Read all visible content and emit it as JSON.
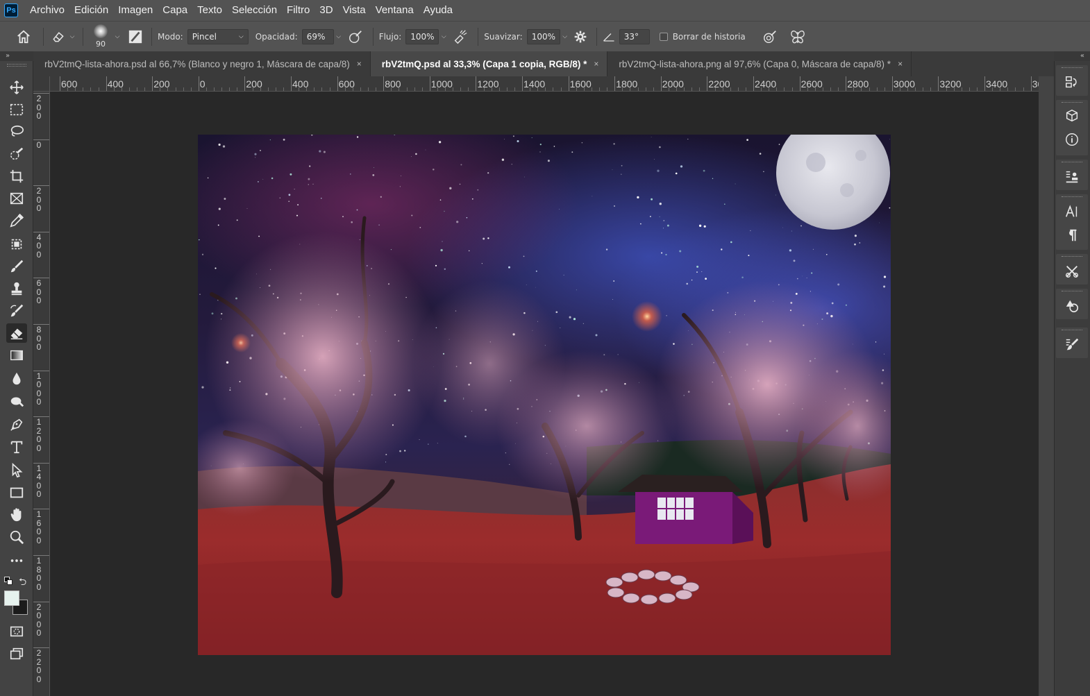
{
  "app": {
    "logo": "Ps"
  },
  "menu": [
    "Archivo",
    "Edición",
    "Imagen",
    "Capa",
    "Texto",
    "Selección",
    "Filtro",
    "3D",
    "Vista",
    "Ventana",
    "Ayuda"
  ],
  "options": {
    "brush_size": "90",
    "mode_label": "Modo:",
    "mode_value": "Pincel",
    "opacity_label": "Opacidad:",
    "opacity_value": "69%",
    "flow_label": "Flujo:",
    "flow_value": "100%",
    "smoothing_label": "Suavizar:",
    "smoothing_value": "100%",
    "angle_value": "33°",
    "erase_history_label": "Borrar de historia"
  },
  "tabs": [
    {
      "title": "rbV2tmQ-lista-ahora.psd al 66,7% (Blanco y negro 1, Máscara de capa/8)",
      "active": false
    },
    {
      "title": "rbV2tmQ.psd al 33,3% (Capa 1 copia, RGB/8) *",
      "active": true
    },
    {
      "title": "rbV2tmQ-lista-ahora.png al 97,6% (Capa 0, Máscara de capa/8) *",
      "active": false
    }
  ],
  "close_glyph": "×",
  "collapse_left": "»",
  "collapse_right": "«",
  "ruler_h": [
    "600",
    "400",
    "200",
    "0",
    "200",
    "400",
    "600",
    "800",
    "1000",
    "1200",
    "1400",
    "1600",
    "1800",
    "2000",
    "2200",
    "2400",
    "2600",
    "2800",
    "3000",
    "3200",
    "3400",
    "36"
  ],
  "ruler_v": [
    "200",
    "0",
    "200",
    "400",
    "600",
    "800",
    "1000",
    "1200",
    "1400",
    "1600",
    "1800",
    "2000",
    "2200"
  ],
  "tools": [
    {
      "name": "move-tool",
      "icon": "move-icon"
    },
    {
      "name": "marquee-tool",
      "icon": "rect-marquee-icon"
    },
    {
      "name": "lasso-tool",
      "icon": "lasso-icon"
    },
    {
      "name": "quick-selection-tool",
      "icon": "quick-selection-icon"
    },
    {
      "name": "crop-tool",
      "icon": "crop-icon"
    },
    {
      "name": "frame-tool",
      "icon": "frame-icon"
    },
    {
      "name": "eyedropper-tool",
      "icon": "eyedropper-icon"
    },
    {
      "name": "healing-tool",
      "icon": "healing-icon"
    },
    {
      "name": "brush-tool",
      "icon": "brush-icon"
    },
    {
      "name": "stamp-tool",
      "icon": "stamp-icon"
    },
    {
      "name": "history-brush-tool",
      "icon": "history-brush-icon"
    },
    {
      "name": "eraser-tool",
      "icon": "eraser-icon",
      "active": true
    },
    {
      "name": "gradient-tool",
      "icon": "gradient-icon"
    },
    {
      "name": "blur-tool",
      "icon": "blur-drop-icon"
    },
    {
      "name": "dodge-tool",
      "icon": "dodge-icon"
    },
    {
      "name": "pen-tool",
      "icon": "pen-icon"
    },
    {
      "name": "type-tool",
      "icon": "type-icon"
    },
    {
      "name": "path-selection-tool",
      "icon": "arrow-icon"
    },
    {
      "name": "shape-tool",
      "icon": "rectangle-icon"
    },
    {
      "name": "hand-tool",
      "icon": "hand-icon"
    },
    {
      "name": "zoom-tool",
      "icon": "zoom-icon"
    },
    {
      "name": "more-tools",
      "icon": "ellipsis-icon"
    }
  ],
  "colors": {
    "foreground": "#e6f2ee",
    "background": "#1b1b1b",
    "accent": "#31a8ff"
  }
}
